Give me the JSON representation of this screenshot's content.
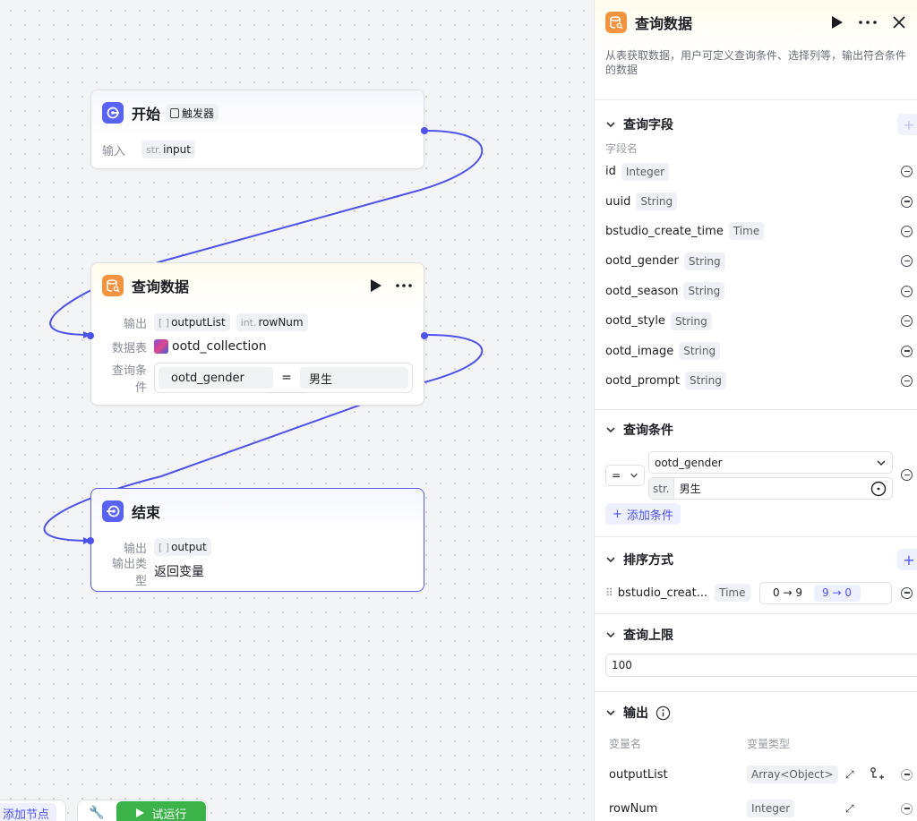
{
  "nodes": {
    "start": {
      "title": "开始",
      "trigger_label": "触发器",
      "input_label": "输入",
      "input_type": "str.",
      "input_name": "input"
    },
    "query": {
      "title": "查询数据",
      "output_label": "输出",
      "outputs": [
        {
          "type": "[ ]",
          "name": "outputList"
        },
        {
          "type": "int.",
          "name": "rowNum"
        }
      ],
      "table_label": "数据表",
      "table_name": "ootd_collection",
      "cond_label": "查询条件",
      "cond_field": "ootd_gender",
      "cond_op": "=",
      "cond_value": "男生"
    },
    "end": {
      "title": "结束",
      "output_label": "输出",
      "output_type": "[ ]",
      "output_name": "output",
      "type_label": "输出类型",
      "type_value": "返回变量"
    }
  },
  "toolbar": {
    "add_node": "添加节点",
    "test_run": "试运行"
  },
  "panel": {
    "title": "查询数据",
    "description": "从表获取数据，用户可定义查询条件、选择列等，输出符合条件的数据",
    "fields_section": "查询字段",
    "field_name_header": "字段名",
    "fields": [
      {
        "name": "id",
        "type": "Integer"
      },
      {
        "name": "uuid",
        "type": "String"
      },
      {
        "name": "bstudio_create_time",
        "type": "Time"
      },
      {
        "name": "ootd_gender",
        "type": "String"
      },
      {
        "name": "ootd_season",
        "type": "String"
      },
      {
        "name": "ootd_style",
        "type": "String"
      },
      {
        "name": "ootd_image",
        "type": "String"
      },
      {
        "name": "ootd_prompt",
        "type": "String"
      }
    ],
    "conditions_section": "查询条件",
    "condition": {
      "operator": "=",
      "field": "ootd_gender",
      "value_type": "str.",
      "value": "男生"
    },
    "add_condition": "添加条件",
    "sort_section": "排序方式",
    "sort": {
      "field": "bstudio_creat...",
      "type": "Time",
      "asc": "0 → 9",
      "desc": "9 → 0"
    },
    "limit_section": "查询上限",
    "limit_value": "100",
    "output_section": "输出",
    "output_headers": {
      "name": "变量名",
      "type": "变量类型"
    },
    "outputs": [
      {
        "name": "outputList",
        "type": "Array<Object>"
      },
      {
        "name": "rowNum",
        "type": "Integer"
      }
    ]
  },
  "colors": {
    "accent": "#4d53e8",
    "start_icon": "#5862f5",
    "query_icon": "#f29340",
    "run_button": "#3cb349"
  }
}
